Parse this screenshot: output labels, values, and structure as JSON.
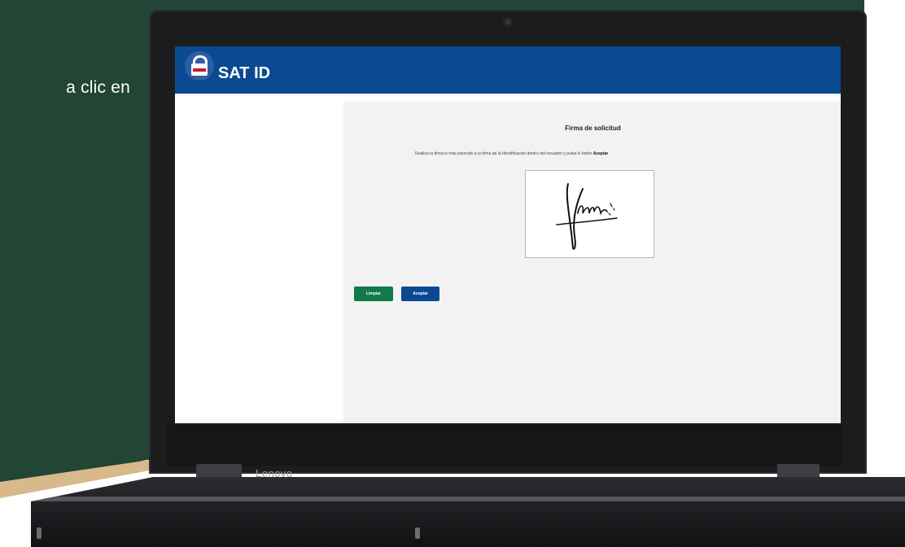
{
  "side_text": "a clic en",
  "device": {
    "brand": "Lenovo"
  },
  "app": {
    "title": "SAT ID",
    "logo_icon": "padlock-icon"
  },
  "signature_page": {
    "heading": "Firma de solicitud",
    "instruction_prefix": "Realiza tu firma lo más parecido a la firma de la Identificación dentro del recuadro y pulsa el botón ",
    "instruction_emphasis": "Aceptar",
    "clear_button": "Limpiar",
    "accept_button": "Aceptar"
  },
  "colors": {
    "background": "#224535",
    "header": "#0b4a92",
    "clear_button": "#0f7a4a",
    "accept_button": "#0b4a92"
  }
}
